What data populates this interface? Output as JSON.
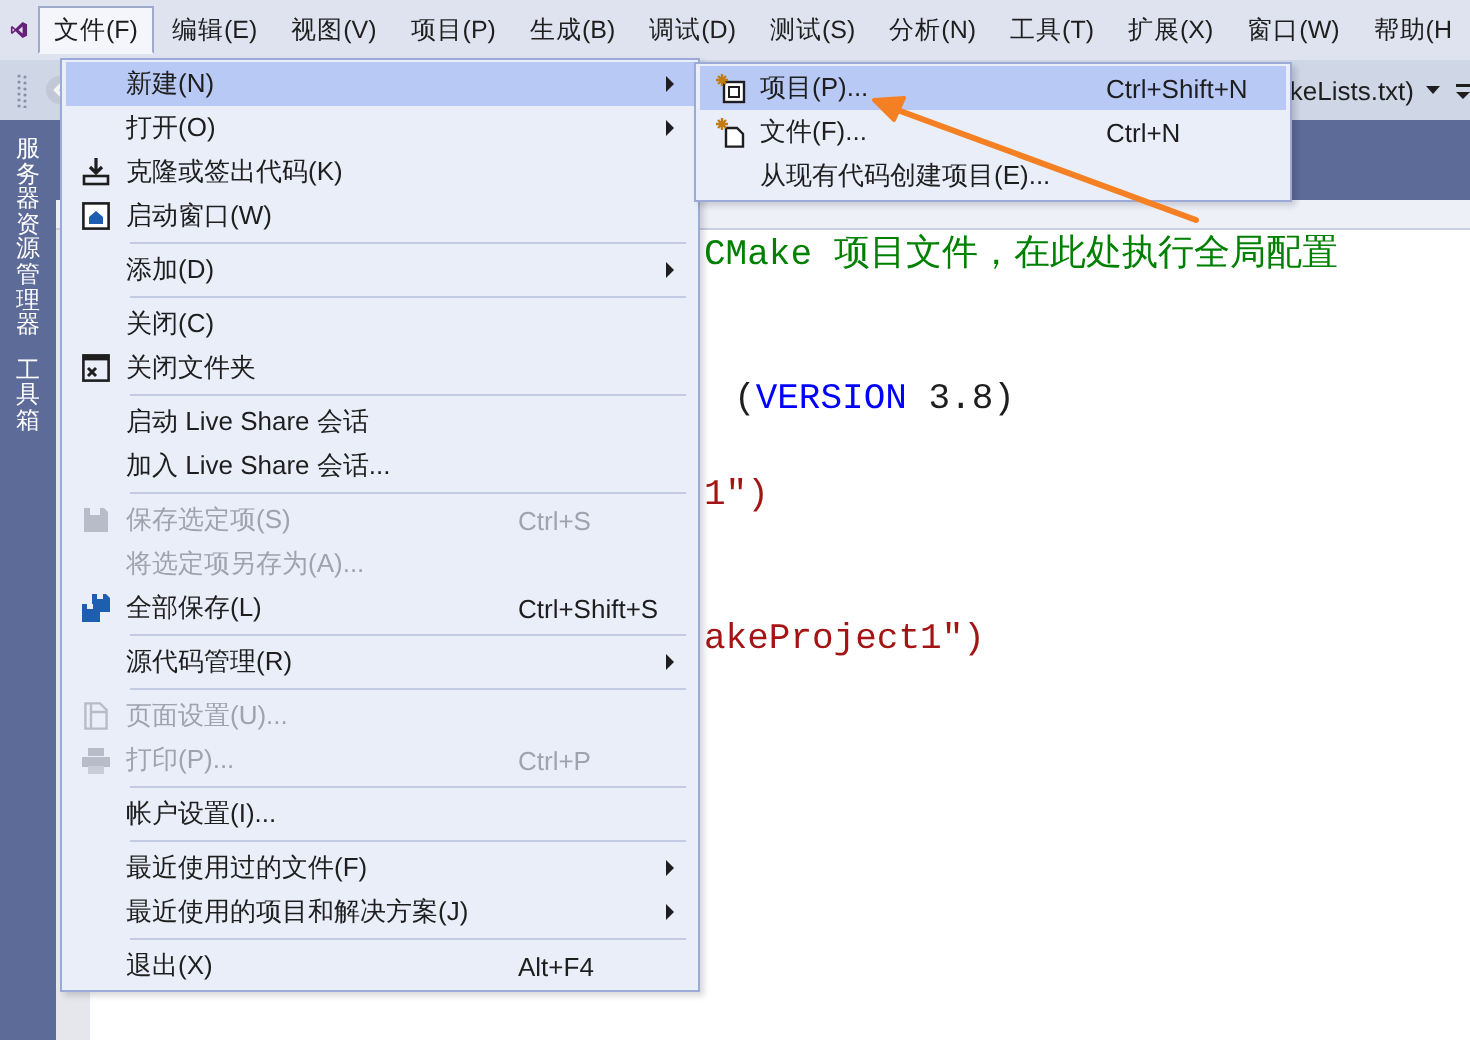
{
  "menubar": {
    "items": [
      {
        "label": "文件(F)",
        "selected": true
      },
      {
        "label": "编辑(E)",
        "selected": false
      },
      {
        "label": "视图(V)",
        "selected": false
      },
      {
        "label": "项目(P)",
        "selected": false
      },
      {
        "label": "生成(B)",
        "selected": false
      },
      {
        "label": "调试(D)",
        "selected": false
      },
      {
        "label": "测试(S)",
        "selected": false
      },
      {
        "label": "分析(N)",
        "selected": false
      },
      {
        "label": "工具(T)",
        "selected": false
      },
      {
        "label": "扩展(X)",
        "selected": false
      },
      {
        "label": "窗口(W)",
        "selected": false
      },
      {
        "label": "帮助(H",
        "selected": false
      }
    ]
  },
  "toolbar": {
    "document_dropdown": "keLists.txt)"
  },
  "side_panels": [
    {
      "label": "服务器资源管理器"
    },
    {
      "label": "工具箱"
    }
  ],
  "editor": {
    "lines": [
      {
        "tokens": [
          {
            "text": "CMake 项目文件，在此处执行全局配置",
            "kind": "comment"
          }
        ]
      },
      {
        "tokens": [
          {
            "text": "(",
            "kind": "plain"
          },
          {
            "text": "VERSION",
            "kind": "keyword"
          },
          {
            "text": " 3.8)",
            "kind": "plain"
          }
        ]
      },
      {
        "tokens": [
          {
            "text": "1\")",
            "kind": "string"
          }
        ]
      },
      {
        "tokens": [
          {
            "text": "akeProject1\")",
            "kind": "string"
          }
        ]
      }
    ]
  },
  "file_menu": {
    "items": [
      {
        "kind": "item",
        "label": "新建(N)",
        "submenu": true,
        "disabled": false,
        "selected": true
      },
      {
        "kind": "item",
        "label": "打开(O)",
        "submenu": true,
        "disabled": false,
        "selected": false
      },
      {
        "kind": "item",
        "label": "克隆或签出代码(K)",
        "submenu": false,
        "disabled": false,
        "selected": false
      },
      {
        "kind": "item",
        "label": "启动窗口(W)",
        "submenu": false,
        "disabled": false,
        "selected": false
      },
      {
        "kind": "separator"
      },
      {
        "kind": "item",
        "label": "添加(D)",
        "submenu": true,
        "disabled": false,
        "selected": false
      },
      {
        "kind": "separator"
      },
      {
        "kind": "item",
        "label": "关闭(C)",
        "submenu": false,
        "disabled": false,
        "selected": false
      },
      {
        "kind": "item",
        "label": "关闭文件夹",
        "submenu": false,
        "disabled": false,
        "selected": false
      },
      {
        "kind": "separator"
      },
      {
        "kind": "item",
        "label": "启动 Live Share 会话",
        "submenu": false,
        "disabled": false,
        "selected": false
      },
      {
        "kind": "item",
        "label": "加入 Live Share 会话...",
        "submenu": false,
        "disabled": false,
        "selected": false
      },
      {
        "kind": "separator"
      },
      {
        "kind": "item",
        "label": "保存选定项(S)",
        "shortcut": "Ctrl+S",
        "submenu": false,
        "disabled": true,
        "selected": false
      },
      {
        "kind": "item",
        "label": "将选定项另存为(A)...",
        "submenu": false,
        "disabled": true,
        "selected": false
      },
      {
        "kind": "item",
        "label": "全部保存(L)",
        "shortcut": "Ctrl+Shift+S",
        "submenu": false,
        "disabled": false,
        "selected": false
      },
      {
        "kind": "separator"
      },
      {
        "kind": "item",
        "label": "源代码管理(R)",
        "submenu": true,
        "disabled": false,
        "selected": false
      },
      {
        "kind": "separator"
      },
      {
        "kind": "item",
        "label": "页面设置(U)...",
        "submenu": false,
        "disabled": true,
        "selected": false
      },
      {
        "kind": "item",
        "label": "打印(P)...",
        "shortcut": "Ctrl+P",
        "submenu": false,
        "disabled": true,
        "selected": false
      },
      {
        "kind": "separator"
      },
      {
        "kind": "item",
        "label": "帐户设置(I)...",
        "submenu": false,
        "disabled": false,
        "selected": false
      },
      {
        "kind": "separator"
      },
      {
        "kind": "item",
        "label": "最近使用过的文件(F)",
        "submenu": true,
        "disabled": false,
        "selected": false
      },
      {
        "kind": "item",
        "label": "最近使用的项目和解决方案(J)",
        "submenu": true,
        "disabled": false,
        "selected": false
      },
      {
        "kind": "separator"
      },
      {
        "kind": "item",
        "label": "退出(X)",
        "shortcut": "Alt+F4",
        "submenu": false,
        "disabled": false,
        "selected": false
      }
    ]
  },
  "new_submenu": {
    "items": [
      {
        "label": "项目(P)...",
        "shortcut": "Ctrl+Shift+N",
        "selected": true
      },
      {
        "label": "文件(F)...",
        "shortcut": "Ctrl+N",
        "selected": false
      },
      {
        "label": "从现有代码创建项目(E)...",
        "selected": false
      }
    ]
  }
}
